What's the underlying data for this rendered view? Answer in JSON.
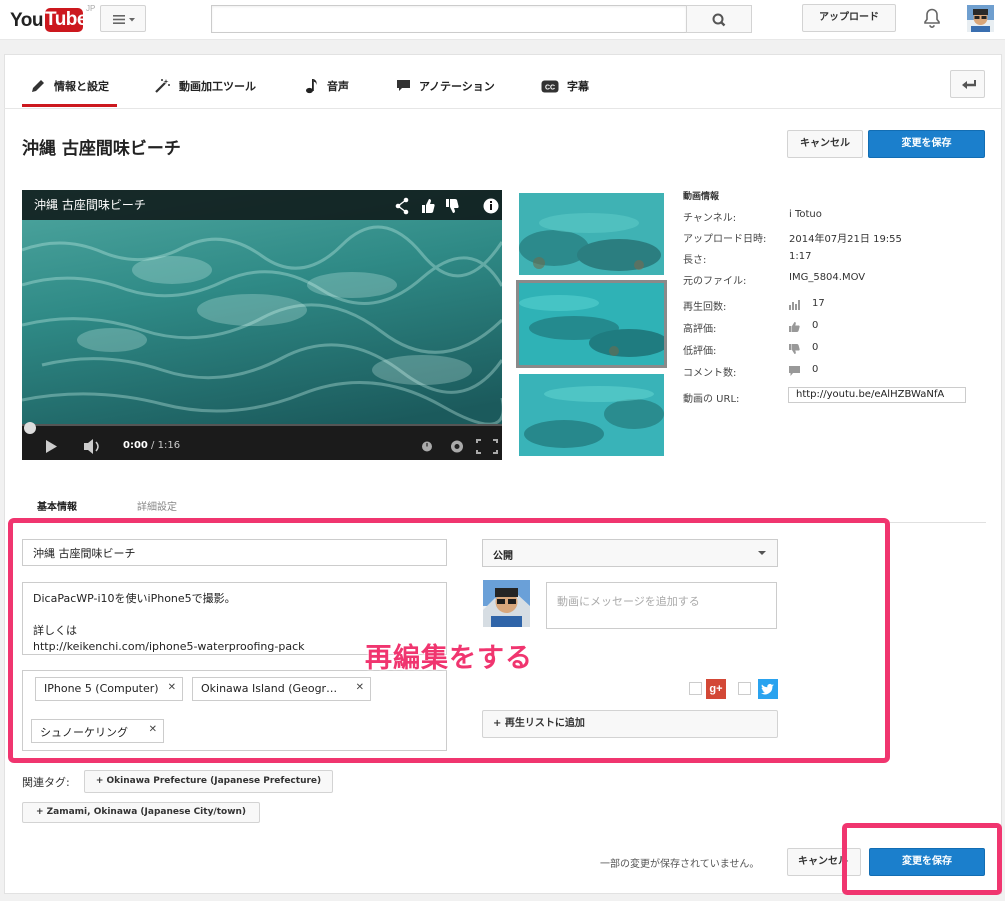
{
  "header": {
    "logo_you": "You",
    "logo_tube": "Tube",
    "logo_region": "JP",
    "search_placeholder": "",
    "upload_label": "アップロード"
  },
  "tabs": [
    {
      "label": "情報と設定",
      "icon": "pencil-icon"
    },
    {
      "label": "動画加工ツール",
      "icon": "magic-wand-icon"
    },
    {
      "label": "音声",
      "icon": "music-note-icon"
    },
    {
      "label": "アノテーション",
      "icon": "speech-bubble-icon"
    },
    {
      "label": "字幕",
      "icon": "cc-icon"
    }
  ],
  "page": {
    "title": "沖縄 古座間味ビーチ",
    "cancel_label": "キャンセル",
    "save_label": "変更を保存"
  },
  "player": {
    "title": "沖縄 古座間味ビーチ",
    "current_time": "0:00",
    "duration": " / 1:16"
  },
  "info": {
    "heading": "動画情報",
    "rows": [
      {
        "key": "チャンネル:",
        "value": "i Totuo"
      },
      {
        "key": "アップロード日時:",
        "value": "2014年07月21日 19:55"
      },
      {
        "key": "長さ:",
        "value": "1:17"
      },
      {
        "key": "元のファイル:",
        "value": "IMG_5804.MOV"
      }
    ],
    "stats": [
      {
        "key": "再生回数:",
        "value": "17",
        "icon": "bar-chart-icon"
      },
      {
        "key": "高評価:",
        "value": "0",
        "icon": "thumbs-up-icon"
      },
      {
        "key": "低評価:",
        "value": "0",
        "icon": "thumbs-down-icon"
      },
      {
        "key": "コメント数:",
        "value": "0",
        "icon": "comment-icon"
      }
    ],
    "url_label": "動画の URL:",
    "url_value": "http://youtu.be/eAlHZBWaNfA"
  },
  "subtabs": {
    "basic": "基本情報",
    "advanced": "詳細設定"
  },
  "form": {
    "title_value": "沖縄 古座間味ビーチ",
    "description_line1": "DicaPacWP-i10を使いiPhone5で撮影。",
    "description_line2": "詳しくは",
    "description_line3": "http://keikenchi.com/iphone5-waterproofing-pack",
    "tags": [
      "IPhone 5 (Computer)",
      "Okinawa Island (Geogr…",
      "シュノーケリング"
    ],
    "privacy_value": "公開",
    "message_placeholder": "動画にメッセージを追加する",
    "gplus_label": "g+",
    "playlist_label": "+ 再生リストに追加",
    "related_label": "関連タグ:",
    "related_tags": [
      "+ Okinawa Prefecture (Japanese Prefecture)",
      "+ Zamami, Okinawa (Japanese City/town)"
    ]
  },
  "annotation": {
    "text": "再編集をする",
    "color": "#f0356f"
  },
  "footer": {
    "unsaved_text": "一部の変更が保存されていません。",
    "cancel_label": "キャンセル",
    "save_label": "変更を保存"
  },
  "colors": {
    "accent_red": "#cc181e",
    "save_blue": "#1b7fcc",
    "annotation_pink": "#f0356f"
  }
}
